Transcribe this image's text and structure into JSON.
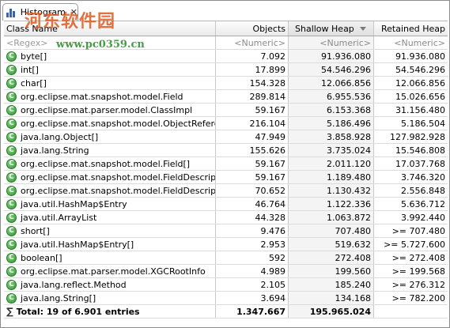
{
  "tab": {
    "title": "Histogram",
    "close": "✕"
  },
  "watermark": {
    "text": "河东软件园",
    "url": "www.pc0359.cn"
  },
  "columns": [
    "Class Name",
    "Objects",
    "Shallow Heap",
    "Retained Heap"
  ],
  "filter": [
    "<Regex>",
    "<Numeric>",
    "<Numeric>",
    "<Numeric>"
  ],
  "rows": [
    [
      "byte[]",
      "7.092",
      "91.936.080",
      "91.936.080"
    ],
    [
      "int[]",
      "17.899",
      "54.546.296",
      "54.546.296"
    ],
    [
      "char[]",
      "154.328",
      "12.066.856",
      "12.066.856"
    ],
    [
      "org.eclipse.mat.snapshot.model.Field",
      "289.814",
      "6.955.536",
      "15.026.656"
    ],
    [
      "org.eclipse.mat.parser.model.ClassImpl",
      "59.167",
      "6.153.368",
      "31.156.480"
    ],
    [
      "org.eclipse.mat.snapshot.model.ObjectReference",
      "216.104",
      "5.186.496",
      "5.186.504"
    ],
    [
      "java.lang.Object[]",
      "47.949",
      "3.858.928",
      "127.982.928"
    ],
    [
      "java.lang.String",
      "155.626",
      "3.735.024",
      "15.546.808"
    ],
    [
      "org.eclipse.mat.snapshot.model.Field[]",
      "59.167",
      "2.011.120",
      "17.037.768"
    ],
    [
      "org.eclipse.mat.snapshot.model.FieldDescriptor[]",
      "59.167",
      "1.189.480",
      "3.746.320"
    ],
    [
      "org.eclipse.mat.snapshot.model.FieldDescriptor",
      "70.652",
      "1.130.432",
      "2.556.848"
    ],
    [
      "java.util.HashMap$Entry",
      "46.764",
      "1.122.336",
      "5.636.712"
    ],
    [
      "java.util.ArrayList",
      "44.328",
      "1.063.872",
      "3.992.440"
    ],
    [
      "short[]",
      "9.476",
      "707.480",
      ">= 707.480"
    ],
    [
      "java.util.HashMap$Entry[]",
      "2.953",
      "519.632",
      ">= 5.727.600"
    ],
    [
      "boolean[]",
      "592",
      "272.408",
      ">= 272.408"
    ],
    [
      "org.eclipse.mat.parser.model.XGCRootInfo",
      "4.989",
      "199.560",
      ">= 199.568"
    ],
    [
      "java.lang.reflect.Method",
      "2.105",
      "185.240",
      ">= 276.312"
    ],
    [
      "java.lang.String[]",
      "3.694",
      "134.168",
      ">= 782.200"
    ]
  ],
  "total": {
    "label": "Total: 19 of 6.901 entries",
    "objects": "1.347.667",
    "shallow": "195.965.024",
    "retained": ""
  },
  "colors": {
    "class_icon": "#2f9a2f",
    "tab_icon": "#3a64a8"
  }
}
